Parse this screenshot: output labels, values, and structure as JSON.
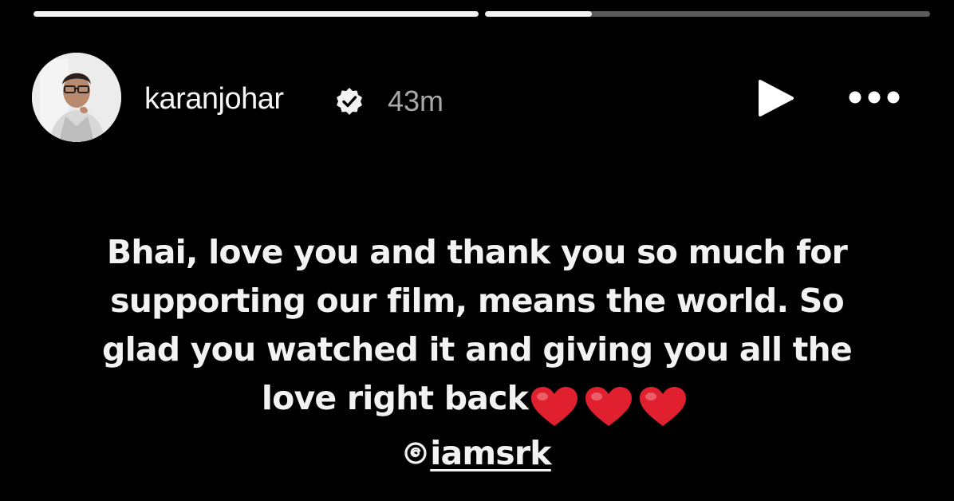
{
  "progress": {
    "segments": [
      {
        "fill": 1.0
      },
      {
        "fill": 0.24
      }
    ]
  },
  "header": {
    "username": "karanjohar",
    "verified": true,
    "timestamp": "43m",
    "play_icon": "play-icon",
    "more_icon": "more-horizontal-icon"
  },
  "caption": {
    "line1": "Bhai, love you and thank you so much for",
    "line2": "supporting our film, means the world. So",
    "line3": "glad you watched it and giving you all the",
    "line4": "love right back",
    "hearts": [
      "❤️",
      "❤️",
      "❤️"
    ],
    "mention": "iamsrk",
    "mention_icon": "threads-icon"
  },
  "colors": {
    "background": "#000000",
    "text": "#f2f2f2",
    "timestamp": "#a8a8a8",
    "progress_track": "#5a5a5a",
    "progress_fill": "#f2f2f2",
    "heart": "#e0202e"
  }
}
